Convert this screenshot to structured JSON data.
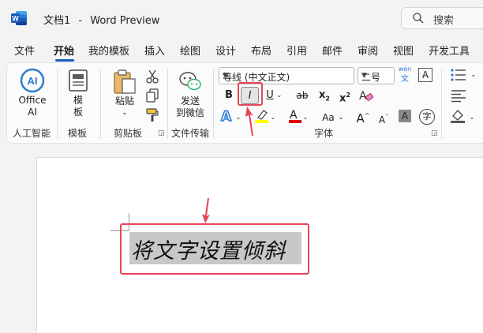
{
  "titlebar": {
    "doc_name": "文档1",
    "separator": "-",
    "app_name": "Word Preview",
    "search_placeholder": "搜索"
  },
  "tabs": [
    {
      "label": "文件"
    },
    {
      "label": "开始",
      "active": true
    },
    {
      "label": "我的模板"
    },
    {
      "label": "插入"
    },
    {
      "label": "绘图"
    },
    {
      "label": "设计"
    },
    {
      "label": "布局"
    },
    {
      "label": "引用"
    },
    {
      "label": "邮件"
    },
    {
      "label": "审阅"
    },
    {
      "label": "视图"
    },
    {
      "label": "开发工具"
    }
  ],
  "ribbon": {
    "office_ai": {
      "line1": "Office",
      "line2": "AI",
      "group": "人工智能"
    },
    "templates": {
      "line1": "模",
      "line2": "板",
      "group": "模板"
    },
    "clipboard": {
      "paste": "粘贴",
      "group": "剪贴板"
    },
    "file_transfer": {
      "line1": "发送",
      "line2": "到微信",
      "group": "文件传输"
    },
    "font": {
      "font_name": "等线 (中文正文)",
      "font_size": "二号",
      "phonetic_top": "wén",
      "phonetic_bottom": "文",
      "bold": "B",
      "italic": "I",
      "underline": "U",
      "strikethrough": "ab",
      "subscript": "x",
      "subscript_mark": "2",
      "superscript": "x",
      "superscript_mark": "2",
      "change_case": "Aa",
      "grow_font": "A",
      "shrink_font": "A",
      "shading": "A",
      "enclose_char": "字",
      "border_char": "A",
      "group": "字体"
    }
  },
  "document": {
    "text": "将文字设置倾斜"
  },
  "colors": {
    "accent": "#185abd",
    "annotation": "#e8445a",
    "highlight_yellow": "#ffff00",
    "font_red": "#e00000"
  }
}
